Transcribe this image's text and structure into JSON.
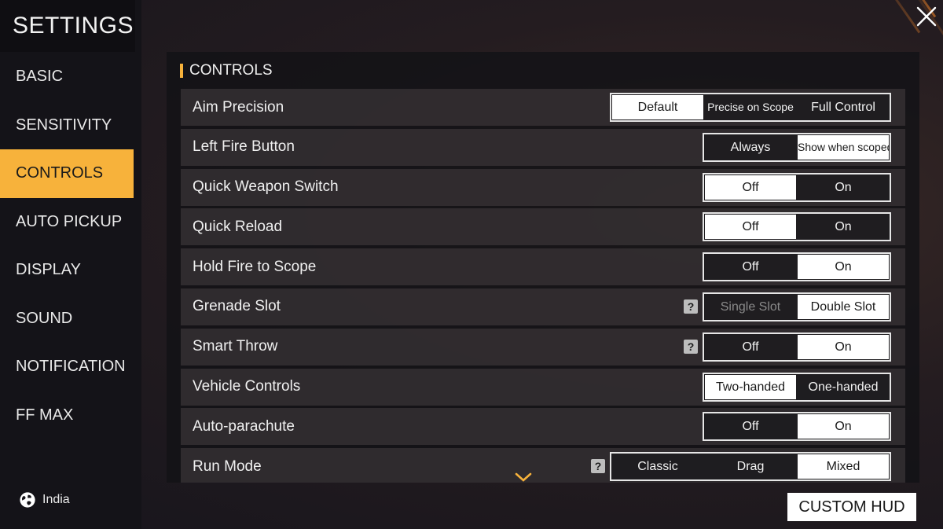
{
  "header": {
    "title": "SETTINGS"
  },
  "sidebar": {
    "items": [
      {
        "label": "BASIC",
        "active": false
      },
      {
        "label": "SENSITIVITY",
        "active": false
      },
      {
        "label": "CONTROLS",
        "active": true
      },
      {
        "label": "AUTO PICKUP",
        "active": false
      },
      {
        "label": "DISPLAY",
        "active": false
      },
      {
        "label": "SOUND",
        "active": false
      },
      {
        "label": "NOTIFICATION",
        "active": false
      },
      {
        "label": "FF MAX",
        "active": false
      }
    ],
    "region": {
      "label": "India",
      "icon": "globe-icon"
    }
  },
  "section": {
    "title": "CONTROLS"
  },
  "help_glyph": "?",
  "rows": [
    {
      "label": "Aim Precision",
      "help": false,
      "options": [
        "Default",
        "Precise on Scope",
        "Full Control"
      ],
      "selected": 0
    },
    {
      "label": "Left Fire Button",
      "help": false,
      "options": [
        "Always",
        "Show when scoped"
      ],
      "selected": 1
    },
    {
      "label": "Quick Weapon Switch",
      "help": false,
      "options": [
        "Off",
        "On"
      ],
      "selected": 0
    },
    {
      "label": "Quick Reload",
      "help": false,
      "options": [
        "Off",
        "On"
      ],
      "selected": 0
    },
    {
      "label": "Hold Fire to Scope",
      "help": false,
      "options": [
        "Off",
        "On"
      ],
      "selected": 1
    },
    {
      "label": "Grenade Slot",
      "help": true,
      "options": [
        "Single Slot",
        "Double Slot"
      ],
      "selected": 1,
      "disabled_option": 0
    },
    {
      "label": "Smart Throw",
      "help": true,
      "options": [
        "Off",
        "On"
      ],
      "selected": 1
    },
    {
      "label": "Vehicle Controls",
      "help": false,
      "options": [
        "Two-handed",
        "One-handed"
      ],
      "selected": 0
    },
    {
      "label": "Auto-parachute",
      "help": false,
      "options": [
        "Off",
        "On"
      ],
      "selected": 1
    },
    {
      "label": "Run Mode",
      "help": true,
      "options": [
        "Classic",
        "Drag",
        "Mixed"
      ],
      "selected": 2
    }
  ],
  "footer": {
    "custom_hud_label": "CUSTOM HUD"
  },
  "colors": {
    "accent": "#f7b23b",
    "selected_bg": "#ffffff",
    "row_bg": "#3a3437"
  }
}
